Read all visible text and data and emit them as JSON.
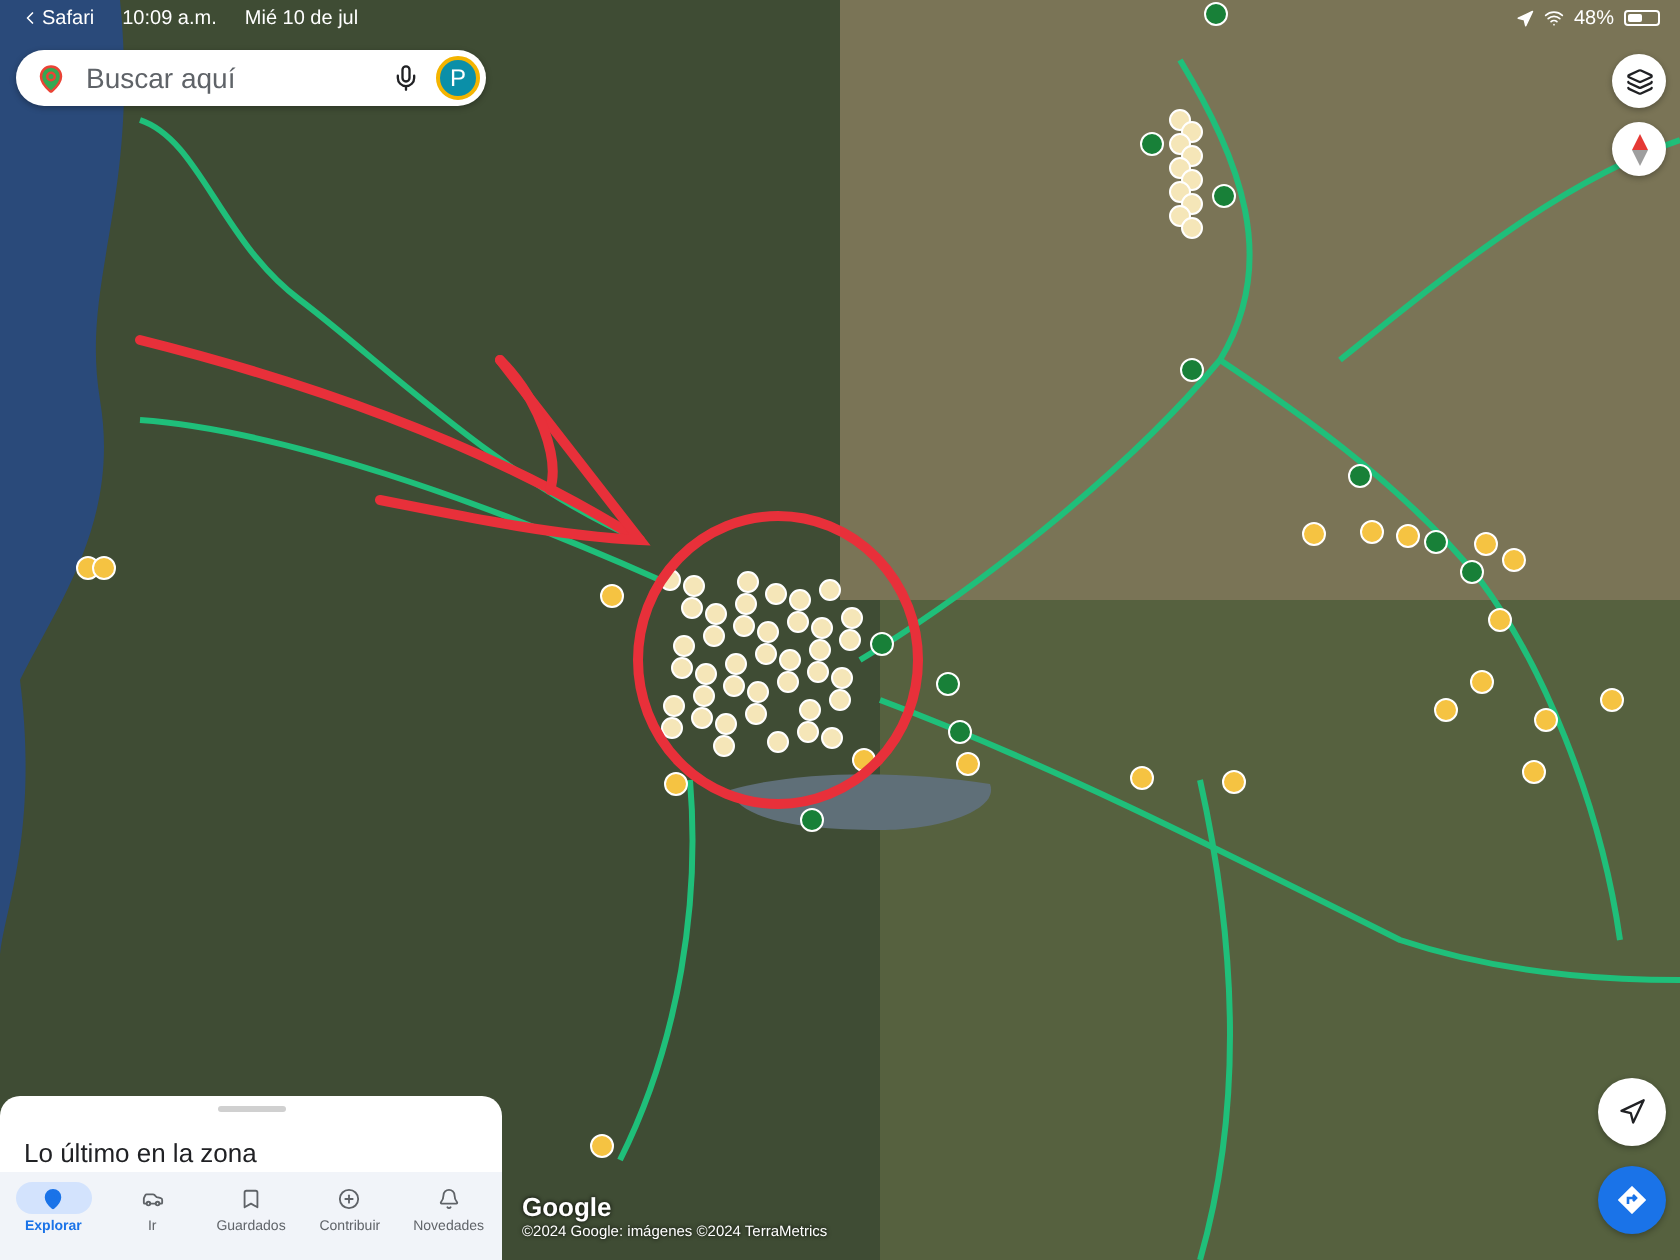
{
  "status_bar": {
    "back_app": "Safari",
    "time": "10:09 a.m.",
    "date": "Mié 10 de jul",
    "battery": "48%"
  },
  "search": {
    "placeholder": "Buscar aquí",
    "avatar_letter": "P"
  },
  "bottom_sheet": {
    "title": "Lo último en la zona"
  },
  "tabs": [
    {
      "label": "Explorar",
      "selected": true
    },
    {
      "label": "Ir",
      "selected": false
    },
    {
      "label": "Guardados",
      "selected": false
    },
    {
      "label": "Contribuir",
      "selected": false
    },
    {
      "label": "Novedades",
      "selected": false
    }
  ],
  "map_footer": {
    "logo": "Google",
    "attribution": "©2024 Google: imágenes ©2024 TerraMetrics"
  }
}
